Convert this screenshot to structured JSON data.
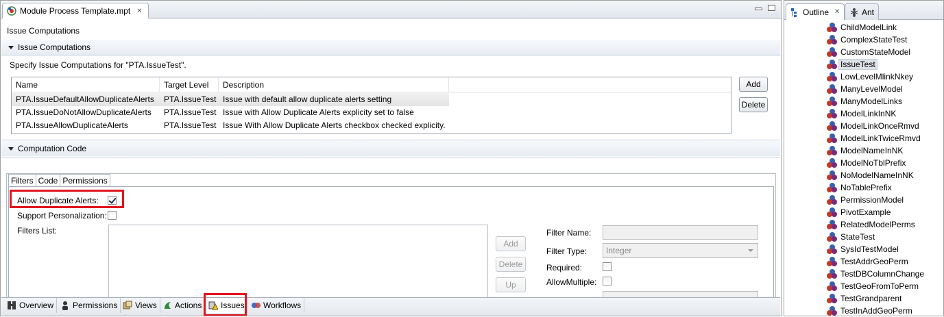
{
  "editor": {
    "tab_title": "Module Process Template.mpt",
    "header_title": "Issue Computations",
    "section_issue": "Issue Computations",
    "description": "Specify Issue Computations for \"PTA.IssueTest\".",
    "columns": [
      "Name",
      "Target Level",
      "Description"
    ],
    "rows": [
      {
        "name": "PTA.IssueDefaultAllowDuplicateAlerts",
        "level": "PTA.IssueTest",
        "desc": "Issue with default allow duplicate alerts setting"
      },
      {
        "name": "PTA.IssueDoNotAllowDuplicateAlerts",
        "level": "PTA.IssueTest",
        "desc": "Issue with Allow Duplicate Alerts explicity set to false"
      },
      {
        "name": "PTA.IssueAllowDuplicateAlerts",
        "level": "PTA.IssueTest",
        "desc": "Issue With Allow Duplicate Alerts checkbox checked explicity."
      }
    ],
    "add_label": "Add",
    "delete_label": "Delete",
    "section_code": "Computation Code",
    "inner_tabs": [
      "Filters",
      "Code",
      "Permissions"
    ],
    "allow_dup_label": "Allow Duplicate Alerts:",
    "allow_dup_checked": true,
    "support_pers_label": "Support Personalization:",
    "filters_list_label": "Filters List:",
    "filter_add": "Add",
    "filter_delete": "Delete",
    "filter_up": "Up",
    "filter_name_label": "Filter Name:",
    "filter_type_label": "Filter Type:",
    "filter_type_value": "Integer",
    "required_label": "Required:",
    "allow_multiple_label": "AllowMultiple:",
    "page_tabs": [
      "Overview",
      "Permissions",
      "Views",
      "Actions",
      "Issues",
      "Workflows"
    ],
    "active_page_tab": "Issues"
  },
  "outline": {
    "tab_outline": "Outline",
    "tab_ant": "Ant",
    "items": [
      "ChildModelLink",
      "ComplexStateTest",
      "CustomStateModel",
      "IssueTest",
      "LowLevelMlinkNkey",
      "ManyLevelModel",
      "ManyModelLinks",
      "ModelLinkInNK",
      "ModelLinkOnceRmvd",
      "ModelLinkTwiceRmvd",
      "ModelNameInNK",
      "ModelNoTblPrefix",
      "NoModelNameInNK",
      "NoTablePrefix",
      "PermissionModel",
      "PivotExample",
      "RelatedModelPerms",
      "StateTest",
      "SysIdTestModel",
      "TestAddrGeoPerm",
      "TestDBColumnChange",
      "TestGeoFromToPerm",
      "TestGrandparent",
      "TestInAddGeoPerm"
    ],
    "selected": "IssueTest"
  },
  "colors": {
    "highlight": "#e0141e",
    "accent": "#3b6fb6"
  }
}
